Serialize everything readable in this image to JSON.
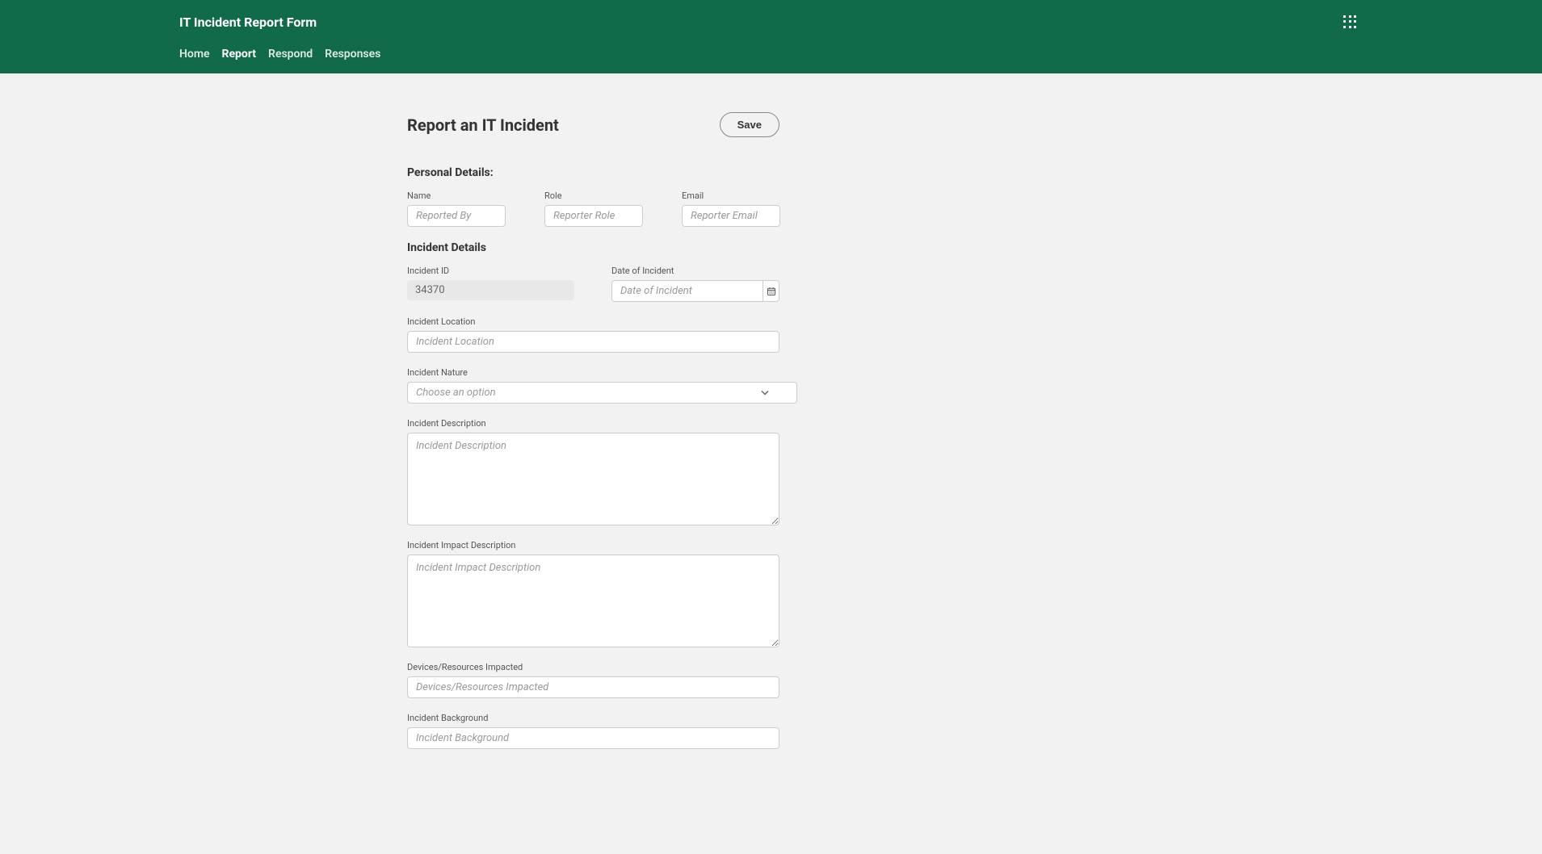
{
  "header": {
    "title": "IT Incident Report Form"
  },
  "nav": {
    "tabs": [
      {
        "label": "Home",
        "active": false
      },
      {
        "label": "Report",
        "active": true
      },
      {
        "label": "Respond",
        "active": false
      },
      {
        "label": "Responses",
        "active": false
      }
    ]
  },
  "page": {
    "title": "Report an IT Incident",
    "save_label": "Save"
  },
  "sections": {
    "personal_details": "Personal Details:",
    "incident_details": "Incident Details"
  },
  "fields": {
    "name": {
      "label": "Name",
      "placeholder": "Reported By"
    },
    "role": {
      "label": "Role",
      "placeholder": "Reporter Role"
    },
    "email": {
      "label": "Email",
      "placeholder": "Reporter Email"
    },
    "incident_id": {
      "label": "Incident ID",
      "value": "34370"
    },
    "date_of_incident": {
      "label": "Date of Incident",
      "placeholder": "Date of Incident"
    },
    "incident_location": {
      "label": "Incident Location",
      "placeholder": "Incident Location"
    },
    "incident_nature": {
      "label": "Incident Nature",
      "placeholder": "Choose an option"
    },
    "incident_description": {
      "label": "Incident Description",
      "placeholder": "Incident Description"
    },
    "incident_impact_description": {
      "label": "Incident Impact Description",
      "placeholder": "Incident Impact Description"
    },
    "devices_resources_impacted": {
      "label": "Devices/Resources Impacted",
      "placeholder": "Devices/Resources Impacted"
    },
    "incident_background": {
      "label": "Incident Background",
      "placeholder": "Incident Background"
    }
  }
}
